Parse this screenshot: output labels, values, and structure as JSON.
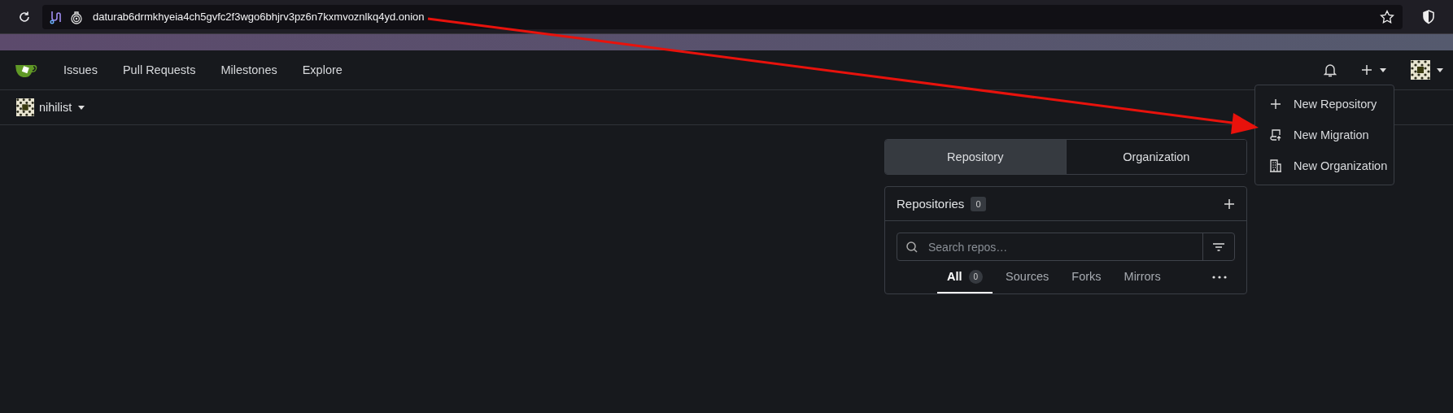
{
  "browser": {
    "url": "daturab6drmkhyeia4ch5gvfc2f3wgo6bhjrv3pz6n7kxmvoznlkq4yd.onion"
  },
  "nav": {
    "items": [
      "Issues",
      "Pull Requests",
      "Milestones",
      "Explore"
    ]
  },
  "context": {
    "user": "nihilist"
  },
  "dashboard_tabs": [
    {
      "label": "Repository",
      "selected": true
    },
    {
      "label": "Organization",
      "selected": false
    }
  ],
  "repos": {
    "title": "Repositories",
    "count": "0",
    "search": {
      "placeholder": "Search repos…"
    },
    "filters": [
      {
        "label": "All",
        "count": "0",
        "selected": true
      },
      {
        "label": "Sources",
        "selected": false
      },
      {
        "label": "Forks",
        "selected": false
      },
      {
        "label": "Mirrors",
        "selected": false
      }
    ]
  },
  "create_menu": [
    {
      "kind": "repository",
      "label": "New Repository"
    },
    {
      "kind": "migration",
      "label": "New Migration"
    },
    {
      "kind": "organization",
      "label": "New Organization"
    }
  ]
}
